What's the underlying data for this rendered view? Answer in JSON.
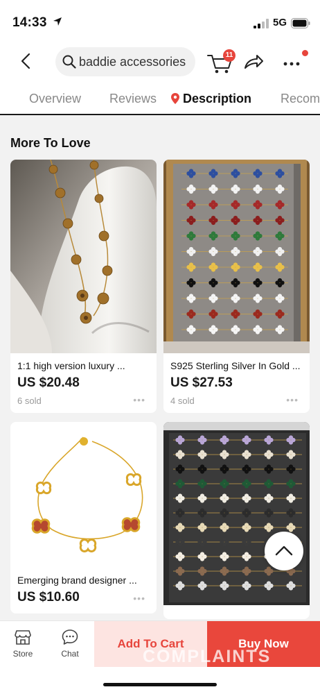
{
  "status_bar": {
    "time": "14:33",
    "network": "5G"
  },
  "header": {
    "search_text": "baddie accessories",
    "cart_count": "11"
  },
  "tabs": [
    {
      "label": "Overview"
    },
    {
      "label": "Reviews"
    },
    {
      "label": "Description",
      "active": true
    },
    {
      "label": "Recom"
    }
  ],
  "section": {
    "title": "More To Love"
  },
  "products": [
    {
      "title": "1:1 high version luxury ...",
      "price": "US $20.48",
      "sold": "6 sold"
    },
    {
      "title": "S925 Sterling Silver In Gold ...",
      "price": "US $27.53",
      "sold": "4 sold"
    },
    {
      "title": "Emerging brand designer ...",
      "price": "US $10.60"
    },
    {
      "title": ""
    }
  ],
  "bottom_bar": {
    "store_label": "Store",
    "chat_label": "Chat",
    "add_to_cart_label": "Add To Cart",
    "buy_now_label": "Buy Now"
  },
  "watermark": "COMPLAINTS",
  "colors": {
    "accent": "#e7453c",
    "accent_light": "#fde4e1",
    "text": "#111111",
    "muted": "#999999"
  },
  "icons": [
    "location-arrow-icon",
    "signal-icon",
    "battery-icon",
    "back-icon",
    "search-icon",
    "cart-icon",
    "share-icon",
    "more-icon",
    "pin-icon",
    "chevron-up-icon",
    "store-icon",
    "chat-icon"
  ]
}
